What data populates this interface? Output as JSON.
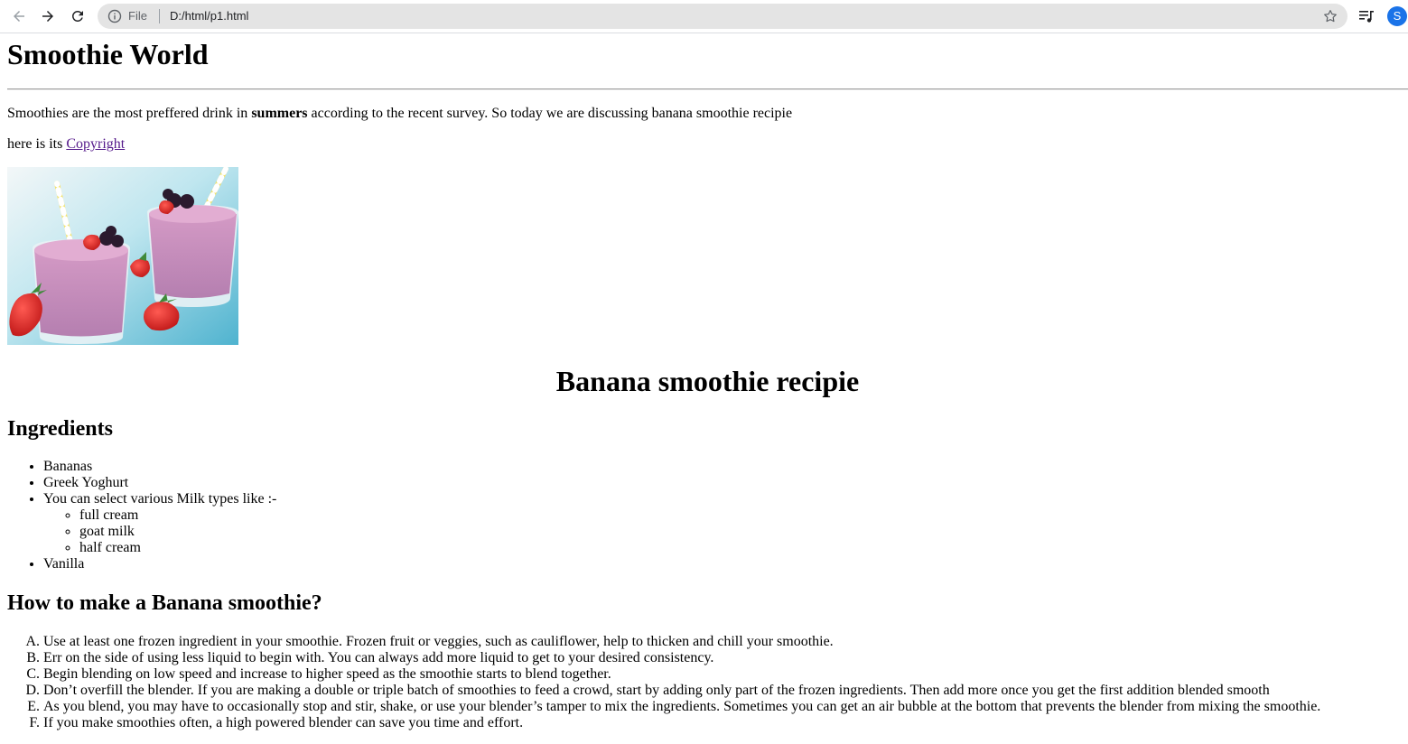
{
  "browser": {
    "scheme_label": "File",
    "url": "D:/html/p1.html",
    "avatar_letter": "S",
    "accent_color": "#1a73e8"
  },
  "page": {
    "title": "Smoothie World",
    "intro_before": "Smoothies are the most preffered drink in ",
    "intro_bold": "summers",
    "intro_after": " according to the recent survey. So today we are discussing banana smoothie recipie",
    "copyright_prefix": "here is its ",
    "copyright_link": "Copyright",
    "recipe_heading": "Banana smoothie recipie",
    "ingredients_heading": "Ingredients",
    "ingredients": {
      "item1": "Bananas",
      "item2": "Greek Yoghurt",
      "item3": "You can select various Milk types like :-",
      "milk_types": [
        "full cream",
        "goat milk",
        "half cream"
      ],
      "item4": "Vanilla"
    },
    "how_heading": "How to make a Banana smoothie?",
    "steps": [
      "Use at least one frozen ingredient in your smoothie. Frozen fruit or veggies, such as cauliflower, help to thicken and chill your smoothie.",
      "Err on the side of using less liquid to begin with. You can always add more liquid to get to your desired consistency.",
      "Begin blending on low speed and increase to higher speed as the smoothie starts to blend together.",
      "Don’t overfill the blender. If you are making a double or triple batch of smoothies to feed a crowd, start by adding only part of the frozen ingredients. Then add more once you get the first addition blended smooth",
      "As you blend, you may have to occasionally stop and stir, shake, or use your blender’s tamper to mix the ingredients. Sometimes you can get an air bubble at the bottom that prevents the blender from mixing the smoothie.",
      "If you make smoothies often, a high powered blender can save you time and effort."
    ]
  }
}
